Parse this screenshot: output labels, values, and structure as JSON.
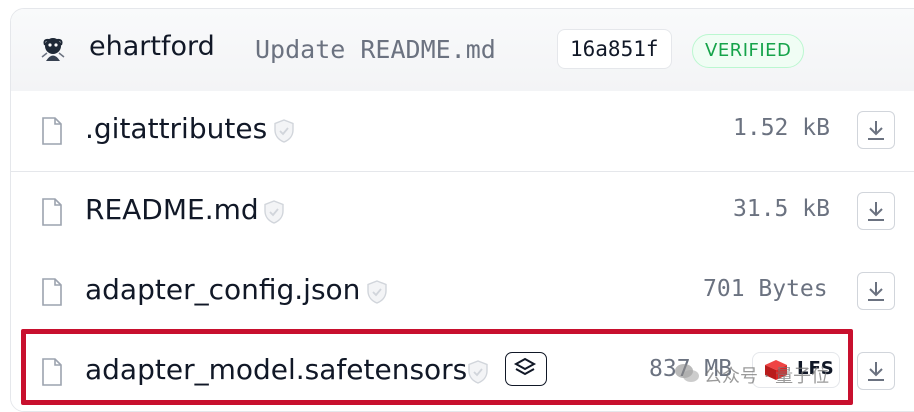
{
  "commit": {
    "author": "ehartford",
    "message": "Update README.md",
    "hash": "16a851f",
    "verified_label": "VERIFIED"
  },
  "files": [
    {
      "name": ".gitattributes",
      "size": "1.52 kB"
    },
    {
      "name": "README.md",
      "size": "31.5 kB"
    },
    {
      "name": "adapter_config.json",
      "size": "701 Bytes"
    },
    {
      "name": "adapter_model.safetensors",
      "size": "837 MB",
      "lfs_label": "LFS"
    }
  ],
  "watermark": "公众号 · 量子位",
  "colors": {
    "highlight": "#c8102e",
    "verified": "#16a34a",
    "lfs_accent": "#dc2626"
  }
}
